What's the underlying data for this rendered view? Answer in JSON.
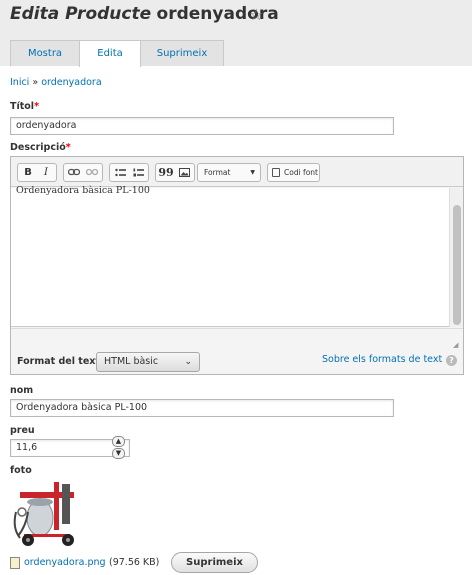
{
  "header": {
    "title_prefix": "Edita Producte",
    "title_name": "ordenyadora",
    "star_icon": "star-outline-icon"
  },
  "tabs": [
    {
      "label": "Mostra",
      "active": false
    },
    {
      "label": "Edita",
      "active": true
    },
    {
      "label": "Suprimeix",
      "active": false
    }
  ],
  "breadcrumb": {
    "home": "Inici",
    "separator": "»",
    "current": "ordenyadora"
  },
  "form": {
    "title": {
      "label": "Títol",
      "required_mark": "*",
      "value": "ordenyadora"
    },
    "description": {
      "label": "Descripció",
      "required_mark": "*",
      "content": "Ordenyadora bàsica PL-100",
      "toolbar": {
        "bold": "B",
        "italic": "I",
        "link_icon": "link-icon",
        "unlink_icon": "unlink-icon",
        "bullet_list_icon": "bulleted-list-icon",
        "numbered_list_icon": "numbered-list-icon",
        "blockquote": "99",
        "image_icon": "image-icon",
        "format_label": "Format",
        "source_label": "Codi font"
      }
    },
    "text_format": {
      "label": "Format del text",
      "selected": "HTML bàsic",
      "help_link": "Sobre els formats de text",
      "help_icon": "?"
    },
    "nom": {
      "label": "nom",
      "value": "Ordenyadora bàsica PL-100"
    },
    "preu": {
      "label": "preu",
      "value": "11,6"
    },
    "foto": {
      "label": "foto",
      "file_name": "ordenyadora.png",
      "file_size": "(97.56 KB)",
      "remove_label": "Suprimeix"
    }
  },
  "colors": {
    "link": "#0071b3",
    "required": "#e00000",
    "header_bg": "#ececec"
  }
}
